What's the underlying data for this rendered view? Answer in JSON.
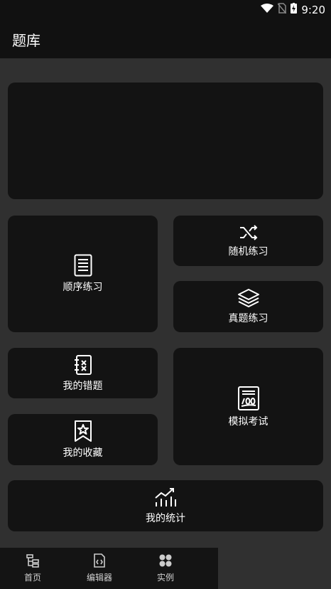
{
  "status": {
    "time": "9:20"
  },
  "appbar": {
    "title": "题库"
  },
  "cards": {
    "sequential": "顺序练习",
    "random": "随机练习",
    "real": "真题练习",
    "wrong": "我的错题",
    "mock": "模拟考试",
    "favorites": "我的收藏",
    "stats": "我的统计"
  },
  "tabs": {
    "home": "首页",
    "editor": "编辑器",
    "examples": "实例"
  },
  "icons": {
    "sequential": "document-list-icon",
    "random": "shuffle-icon",
    "real": "layers-icon",
    "wrong": "notebook-x-icon",
    "mock": "score-100-icon",
    "favorites": "bookmark-star-icon",
    "stats": "chart-trend-icon"
  }
}
